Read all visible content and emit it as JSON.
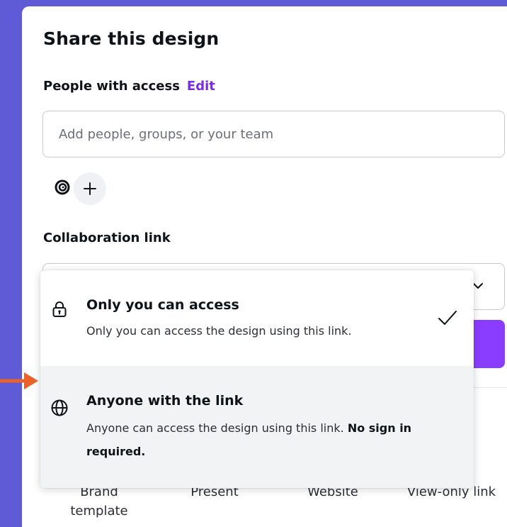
{
  "dialog": {
    "title": "Share this design",
    "people_label": "People with access",
    "edit_label": "Edit",
    "people_input_placeholder": "Add people, groups, or your team",
    "avatar_icon": "spiral-logo-icon",
    "add_person_icon": "plus-icon",
    "collab_label": "Collaboration link"
  },
  "dropdown": {
    "options": [
      {
        "icon": "lock-icon",
        "title": "Only you can access",
        "description": "Only you can access the design using this link.",
        "selected": true
      },
      {
        "icon": "globe-icon",
        "title": "Anyone with the link",
        "description": "Anyone can access the design using this link. ",
        "description_bold": "No sign in required.",
        "hovered": true
      }
    ]
  },
  "share_options": {
    "brand_template_line1": "Brand",
    "brand_template_line2": "template",
    "present": "Present",
    "website": "Website",
    "view_only_link": "View-only link"
  },
  "colors": {
    "background": "#5f5ad6",
    "accent": "#7d2ae8",
    "button": "#8b3dff",
    "annotation_arrow": "#e8622a"
  }
}
